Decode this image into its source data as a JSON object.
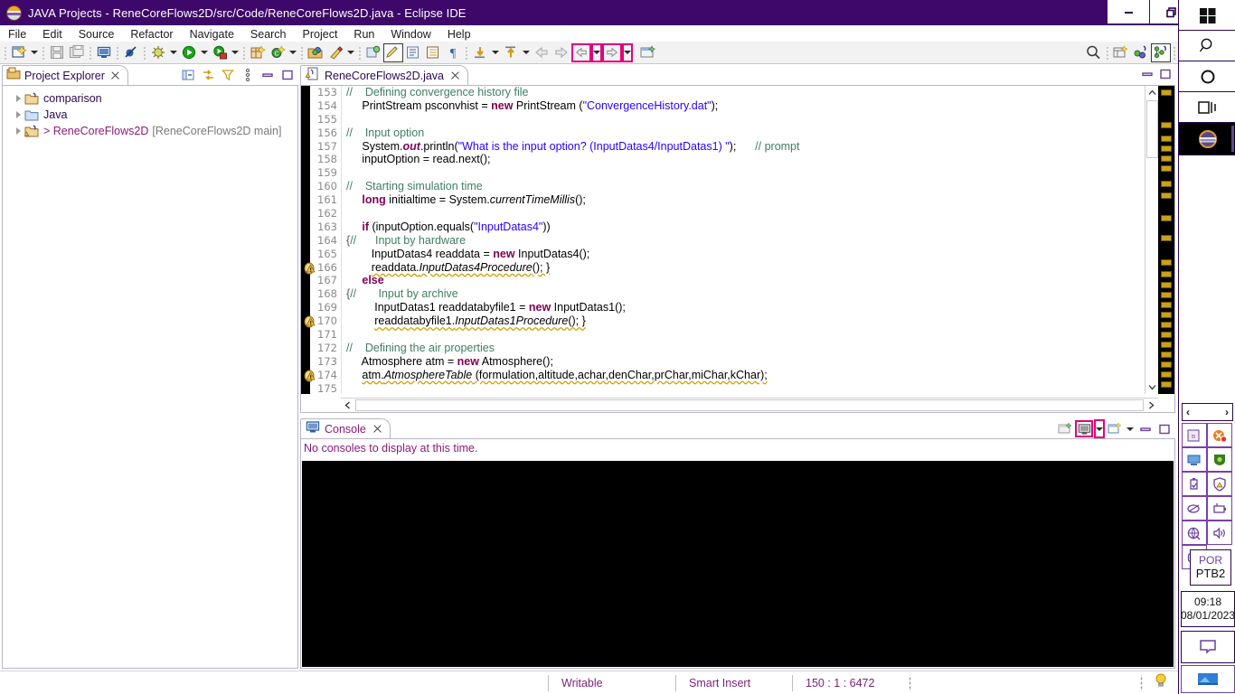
{
  "window": {
    "title": "JAVA Projects - ReneCoreFlows2D/src/Code/ReneCoreFlows2D.java - Eclipse IDE",
    "app_icon": "eclipse-icon",
    "minimize_label": "minimize-icon",
    "maximize_label": "restore-icon",
    "close_label": "close-icon"
  },
  "menubar": {
    "items": [
      {
        "label": "File"
      },
      {
        "label": "Edit"
      },
      {
        "label": "Source"
      },
      {
        "label": "Refactor"
      },
      {
        "label": "Navigate"
      },
      {
        "label": "Search"
      },
      {
        "label": "Project"
      },
      {
        "label": "Run"
      },
      {
        "label": "Window"
      },
      {
        "label": "Help"
      }
    ]
  },
  "toolbar": {
    "items": [
      {
        "name": "new-wizard-icon",
        "kind": "icon"
      },
      {
        "name": "new-wizard-dropdown",
        "kind": "arrow"
      },
      {
        "name": "separator",
        "kind": "sep"
      },
      {
        "name": "save-icon",
        "kind": "icon"
      },
      {
        "name": "save-all-icon",
        "kind": "icon"
      },
      {
        "name": "separator",
        "kind": "sep"
      },
      {
        "name": "open-console-icon",
        "kind": "icon"
      },
      {
        "name": "separator",
        "kind": "sep"
      },
      {
        "name": "skip-all-breakpoints-icon",
        "kind": "icon"
      },
      {
        "name": "separator",
        "kind": "sep"
      },
      {
        "name": "debug-icon",
        "kind": "icon"
      },
      {
        "name": "debug-dropdown",
        "kind": "arrow"
      },
      {
        "name": "run-icon",
        "kind": "icon"
      },
      {
        "name": "run-dropdown",
        "kind": "arrow"
      },
      {
        "name": "coverage-icon",
        "kind": "icon"
      },
      {
        "name": "coverage-dropdown",
        "kind": "arrow"
      },
      {
        "name": "separator",
        "kind": "sep"
      },
      {
        "name": "new-java-package-icon",
        "kind": "icon"
      },
      {
        "name": "new-java-class-icon",
        "kind": "icon"
      },
      {
        "name": "new-class-dropdown",
        "kind": "arrow"
      },
      {
        "name": "separator",
        "kind": "sep"
      },
      {
        "name": "open-type-icon",
        "kind": "icon"
      },
      {
        "name": "open-task-icon",
        "kind": "icon"
      },
      {
        "name": "open-task-dropdown",
        "kind": "arrow"
      },
      {
        "name": "separator",
        "kind": "sep"
      },
      {
        "name": "search-type-icon",
        "kind": "icon"
      },
      {
        "name": "toggle-mark-occurrences-icon",
        "kind": "icon-framed"
      },
      {
        "name": "show-whitespace-icon",
        "kind": "icon"
      },
      {
        "name": "show-source-quick-icon",
        "kind": "icon"
      },
      {
        "name": "pilcrow-icon",
        "kind": "icon"
      },
      {
        "name": "separator",
        "kind": "sep"
      },
      {
        "name": "next-annotation-icon",
        "kind": "icon"
      },
      {
        "name": "next-annotation-dropdown",
        "kind": "arrow"
      },
      {
        "name": "previous-annotation-icon",
        "kind": "icon"
      },
      {
        "name": "previous-annotation-dropdown",
        "kind": "arrow"
      },
      {
        "name": "last-edit-location-icon",
        "kind": "icon"
      },
      {
        "name": "forward-edit-icon",
        "kind": "icon"
      },
      {
        "name": "back-navigation-icon",
        "kind": "icon-highlight"
      },
      {
        "name": "back-navigation-dropdown",
        "kind": "arrow-highlight"
      },
      {
        "name": "forward-navigation-icon",
        "kind": "icon-highlight"
      },
      {
        "name": "forward-navigation-dropdown",
        "kind": "arrow-highlight"
      },
      {
        "name": "open-perspective-icon",
        "kind": "icon"
      }
    ],
    "right_items": [
      {
        "name": "quick-access-search-icon",
        "kind": "icon"
      },
      {
        "name": "separator",
        "kind": "sep"
      },
      {
        "name": "open-perspective-button",
        "kind": "icon"
      },
      {
        "name": "java-browsing-perspective-icon",
        "kind": "icon"
      },
      {
        "name": "java-perspective-icon",
        "kind": "icon-framed"
      }
    ],
    "highlight_color": "#e3007b"
  },
  "project_explorer": {
    "tab_label": "Project Explorer",
    "tab_icon": "project-explorer-icon",
    "tools": [
      {
        "name": "collapse-all-icon"
      },
      {
        "name": "link-with-editor-icon"
      },
      {
        "name": "view-menu-filter-icon"
      },
      {
        "name": "view-menu-icon"
      },
      {
        "name": "minimize-view-icon"
      },
      {
        "name": "maximize-view-icon"
      }
    ],
    "tree": [
      {
        "label": "comparison",
        "icon": "java-project-icon",
        "sub": "",
        "expanded": false
      },
      {
        "label": "Java",
        "icon": "folder-icon",
        "sub": "",
        "expanded": false
      },
      {
        "label": "> ReneCoreFlows2D",
        "icon": "java-project-warning-icon",
        "sub": "[ReneCoreFlows2D main]",
        "expanded": false
      }
    ]
  },
  "editor": {
    "tab_label": "ReneCoreFlows2D.java",
    "tab_icon": "java-file-warning-icon",
    "tools": [
      {
        "name": "minimize-editor-icon"
      },
      {
        "name": "maximize-editor-icon"
      }
    ],
    "first_line": 153,
    "lines": [
      {
        "n": 153,
        "marker": "",
        "fold": "",
        "html": "<span class=\"cm\">//    Defining convergence history file</span>"
      },
      {
        "n": 154,
        "marker": "",
        "fold": "",
        "html": "     PrintStream psconvhist = <span class=\"k\">new</span> PrintStream (<span class=\"st\">\"ConvergenceHistory.dat\"</span>);"
      },
      {
        "n": 155,
        "marker": "",
        "fold": "",
        "html": ""
      },
      {
        "n": 156,
        "marker": "",
        "fold": "",
        "html": "<span class=\"cm\">//    Input option</span>"
      },
      {
        "n": 157,
        "marker": "",
        "fold": "",
        "html": "     System.<span class=\"k it\">out</span>.println(<span class=\"st\">\"What is the input option? (InputDatas4/InputDatas1) \"</span>);      <span class=\"cm\">// prompt</span>"
      },
      {
        "n": 158,
        "marker": "",
        "fold": "",
        "html": "     inputOption = read.next();"
      },
      {
        "n": 159,
        "marker": "",
        "fold": "",
        "html": ""
      },
      {
        "n": 160,
        "marker": "",
        "fold": "",
        "html": "<span class=\"cm\">//    Starting simulation time</span>"
      },
      {
        "n": 161,
        "marker": "",
        "fold": "",
        "html": "     <span class=\"k\">long</span> initialtime = System.<span class=\"it\">currentTimeMillis</span>();"
      },
      {
        "n": 162,
        "marker": "",
        "fold": "",
        "html": ""
      },
      {
        "n": 163,
        "marker": "",
        "fold": "",
        "html": "     <span class=\"k\">if</span> (inputOption.equals(<span class=\"st\">\"InputDatas4\"</span>))"
      },
      {
        "n": 164,
        "marker": "",
        "fold": "{",
        "html": "<span class=\"cm\">//      Input by hardware</span>"
      },
      {
        "n": 165,
        "marker": "",
        "fold": "",
        "html": "        InputDatas4 readdata = <span class=\"k\">new</span> InputDatas4();"
      },
      {
        "n": 166,
        "marker": "warning",
        "fold": "",
        "html": "        <span class=\"wu\">readdata.<span class=\"it\">InputDatas4Procedure</span>(); }</span>"
      },
      {
        "n": 167,
        "marker": "",
        "fold": "",
        "html": "     <span class=\"k\">else</span>"
      },
      {
        "n": 168,
        "marker": "",
        "fold": "{",
        "html": "<span class=\"cm\">//       Input by archive</span>"
      },
      {
        "n": 169,
        "marker": "",
        "fold": "",
        "html": "         InputDatas1 readdatabyfile1 = <span class=\"k\">new</span> InputDatas1();"
      },
      {
        "n": 170,
        "marker": "warning",
        "fold": "",
        "html": "         <span class=\"wu\">readdatabyfile1.<span class=\"it\">InputDatas1Procedure</span>(); }</span>"
      },
      {
        "n": 171,
        "marker": "",
        "fold": "",
        "html": ""
      },
      {
        "n": 172,
        "marker": "",
        "fold": "",
        "html": "<span class=\"cm\">//    Defining the air properties</span>"
      },
      {
        "n": 173,
        "marker": "",
        "fold": "",
        "html": "     Atmosphere atm = <span class=\"k\">new</span> Atmosphere();"
      },
      {
        "n": 174,
        "marker": "warning",
        "fold": "",
        "html": "     <span class=\"wu\">atm.<span class=\"it\">AtmosphereTable</span> (formulation,altitude,achar,denChar,prChar,miChar,kChar);</span>"
      },
      {
        "n": 175,
        "marker": "",
        "fold": "",
        "html": ""
      }
    ],
    "overview_marker_color": "#c8a21d",
    "vscroll_up_icon": "scroll-up-icon",
    "vscroll_down_icon": "scroll-down-icon",
    "hscroll_left_icon": "scroll-left-icon",
    "hscroll_right_icon": "scroll-right-icon"
  },
  "console": {
    "tab_label": "Console",
    "tab_icon": "console-icon",
    "message": "No consoles to display at this time.",
    "tools": [
      {
        "name": "open-console-view-icon",
        "kind": "plain"
      },
      {
        "name": "display-selected-console-icon",
        "kind": "highlight"
      },
      {
        "name": "display-console-dropdown",
        "kind": "arrow-highlight"
      },
      {
        "name": "open-console-icon",
        "kind": "plain"
      },
      {
        "name": "open-console-dropdown",
        "kind": "arrow"
      },
      {
        "name": "minimize-console-icon",
        "kind": "plain"
      },
      {
        "name": "maximize-console-icon",
        "kind": "plain"
      }
    ],
    "highlight_color": "#e3007b"
  },
  "statusbar": {
    "writable": "Writable",
    "insert_mode": "Smart Insert",
    "position": "150 : 1 : 6472",
    "tip_icon": "lightbulb-icon"
  },
  "taskbar": {
    "buttons": [
      {
        "name": "start-button-icon"
      },
      {
        "name": "search-icon"
      },
      {
        "name": "cortana-icon"
      },
      {
        "name": "task-view-icon"
      }
    ],
    "app": {
      "name": "eclipse-taskbar-icon"
    },
    "tray_scroll_left": "‹",
    "tray_scroll_right": "›",
    "tray": [
      {
        "name": "onedrive-tray-icon"
      },
      {
        "name": "antivirus-tray-icon"
      },
      {
        "name": "display-tray-icon"
      },
      {
        "name": "nvidia-tray-icon"
      },
      {
        "name": "safely-remove-hardware-icon"
      },
      {
        "name": "security-warning-tray-icon"
      },
      {
        "name": "mouse-tray-icon"
      },
      {
        "name": "battery-tray-icon"
      },
      {
        "name": "network-disconnected-icon"
      },
      {
        "name": "volume-tray-icon"
      },
      {
        "name": "webcam-tray-icon"
      }
    ],
    "language": {
      "top": "POR",
      "bottom": "PTB2"
    },
    "clock": {
      "time": "09:18",
      "date": "08/01/2023"
    },
    "notifications_icon": "action-center-icon",
    "show_desktop_icon": "show-desktop-icon"
  }
}
